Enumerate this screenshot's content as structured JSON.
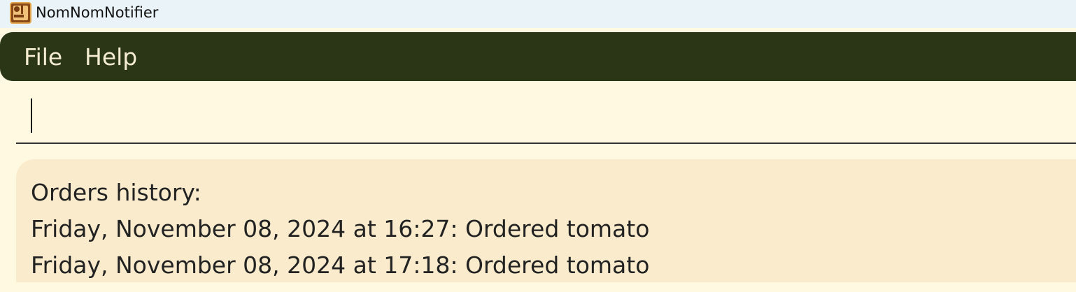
{
  "window": {
    "title": "NomNomNotifier",
    "icon": "app-logo-icon"
  },
  "menu": {
    "items": [
      "File",
      "Help"
    ]
  },
  "command_box": {
    "value": "",
    "placeholder": ""
  },
  "history": {
    "heading": "Orders history:",
    "entries": [
      "Friday, November 08, 2024 at 16:27: Ordered tomato",
      "Friday, November 08, 2024 at 17:18: Ordered tomato"
    ]
  },
  "colors": {
    "menubar_bg": "#2b3617",
    "menu_text": "#f4ecd0",
    "page_bg": "#fff9e1",
    "panel_bg": "#faebcc",
    "titlebar_bg": "#eaf3f7"
  }
}
